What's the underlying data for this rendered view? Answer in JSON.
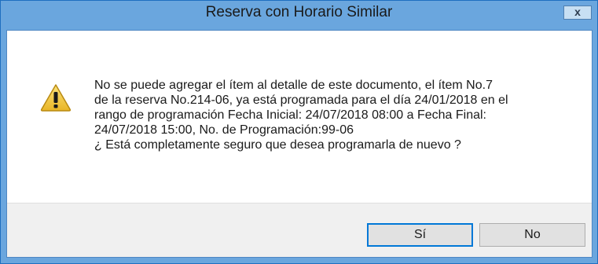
{
  "window": {
    "title": "Reserva con Horario Similar",
    "close_label": "x"
  },
  "dialog": {
    "icon": "warning-icon",
    "message_lines": [
      "No se puede agregar el ítem al detalle de este documento, el ítem No.7",
      "de la reserva No.214-06, ya está programada para el día 24/01/2018 en el",
      "rango de programación Fecha Inicial: 24/07/2018 08:00 a Fecha Final:",
      "24/07/2018 15:00, No. de Programación:99-06",
      "¿ Está completamente seguro que desea programarla de nuevo ?"
    ]
  },
  "buttons": {
    "yes_label": "Sí",
    "no_label": "No"
  },
  "colors": {
    "titlebar": "#6aa6de",
    "footer": "#f0f0f0",
    "default_button_border": "#0078d7"
  }
}
